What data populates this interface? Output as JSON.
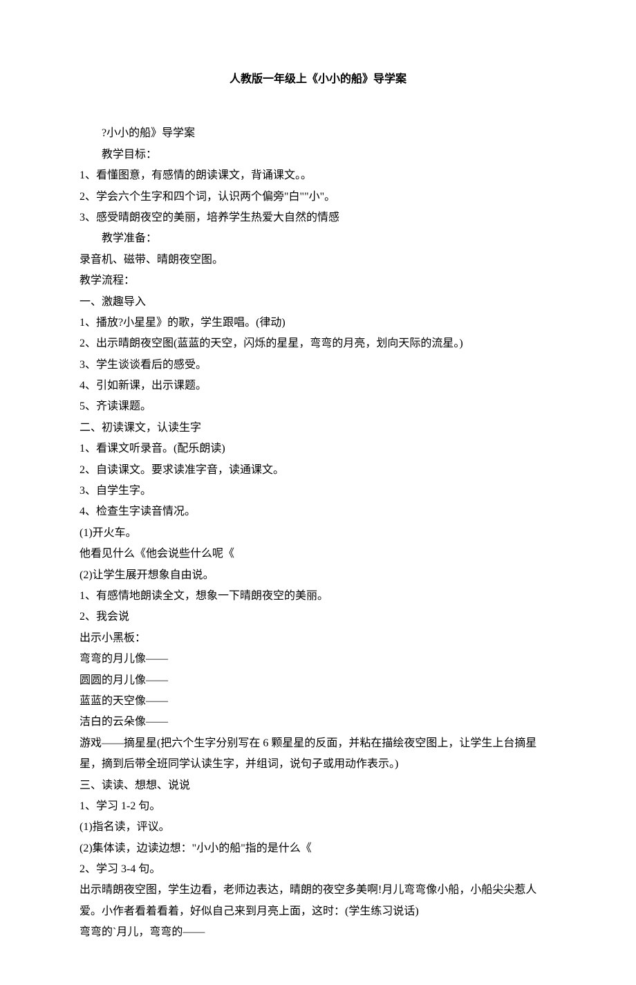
{
  "title": "人教版一年级上《小小的船》导学案",
  "lines": [
    {
      "text": "?小小的船》导学案",
      "indent": true
    },
    {
      "text": "教学目标：",
      "indent": true
    },
    {
      "text": "1、看懂图意，有感情的朗读课文，背诵课文。。",
      "indent": false
    },
    {
      "text": "2、学会六个生字和四个词，认识两个偏旁\"白\"\"小\"。",
      "indent": false
    },
    {
      "text": "3、感受晴朗夜空的美丽，培养学生热爱大自然的情感",
      "indent": false
    },
    {
      "text": "教学准备：",
      "indent": true
    },
    {
      "text": "录音机、磁带、晴朗夜空图。",
      "indent": false
    },
    {
      "text": "教学流程：",
      "indent": false
    },
    {
      "text": "一、激趣导入",
      "indent": false
    },
    {
      "text": "1、播放?小星星》的歌，学生跟唱。(律动)",
      "indent": false
    },
    {
      "text": "2、出示晴朗夜空图(蓝蓝的天空，闪烁的星星，弯弯的月亮，划向天际的流星。)",
      "indent": false
    },
    {
      "text": "3、学生谈谈看后的感受。",
      "indent": false
    },
    {
      "text": "4、引如新课，出示课题。",
      "indent": false
    },
    {
      "text": "5、齐读课题。",
      "indent": false
    },
    {
      "text": "二、初读课文，认读生字",
      "indent": false
    },
    {
      "text": "1、看课文听录音。(配乐朗读)",
      "indent": false
    },
    {
      "text": "2、自读课文。要求读准字音，读通课文。",
      "indent": false
    },
    {
      "text": "3、自学生字。",
      "indent": false
    },
    {
      "text": "4、检查生字读音情况。",
      "indent": false
    },
    {
      "text": "(1)开火车。",
      "indent": false
    },
    {
      "text": "他看见什么《他会说些什么呢《",
      "indent": false
    },
    {
      "text": "(2)让学生展开想象自由说。",
      "indent": false
    },
    {
      "text": "1、有感情地朗读全文，想象一下晴朗夜空的美丽。",
      "indent": false
    },
    {
      "text": "2、我会说",
      "indent": false
    },
    {
      "text": "出示小黑板：",
      "indent": false
    },
    {
      "text": "弯弯的月儿像——",
      "indent": false
    },
    {
      "text": "圆圆的月儿像——",
      "indent": false
    },
    {
      "text": "蓝蓝的天空像——",
      "indent": false
    },
    {
      "text": "洁白的云朵像——",
      "indent": false
    },
    {
      "text": "游戏——摘星星(把六个生字分别写在 6 颗星星的反面，并粘在描绘夜空图上，让学生上台摘星星，摘到后带全班同学认读生字，并组词，说句子或用动作表示。)",
      "indent": false
    },
    {
      "text": "三、读读、想想、说说",
      "indent": false
    },
    {
      "text": "1、学习 1-2 句。",
      "indent": false
    },
    {
      "text": "(1)指名读，评议。",
      "indent": false
    },
    {
      "text": "(2)集体读，边读边想：\"小小的船\"指的是什么《",
      "indent": false
    },
    {
      "text": "2、学习 3-4 句。",
      "indent": false
    },
    {
      "text": "出示晴朗夜空图，学生边看，老师边表达，晴朗的夜空多美啊!月儿弯弯像小船，小船尖尖惹人爱。小作者看着看着，好似自己来到月亮上面，这时：(学生练习说话)",
      "indent": false
    },
    {
      "text": "弯弯的`月儿，弯弯的——",
      "indent": false
    }
  ]
}
